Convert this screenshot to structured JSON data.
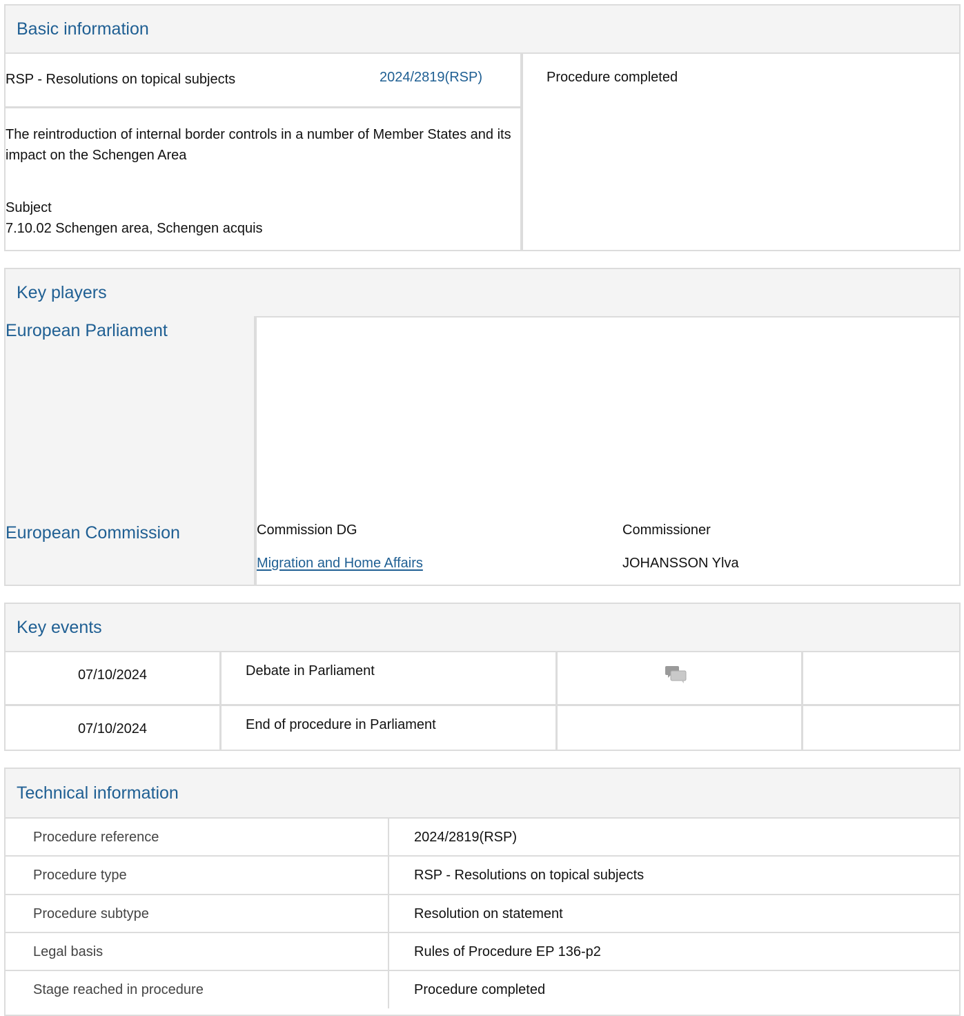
{
  "basic_information": {
    "heading": "Basic information",
    "procedure_type": "RSP - Resolutions on topical subjects",
    "procedure_reference_link": "2024/2819(RSP)",
    "status": "Procedure completed",
    "title": "The reintroduction of internal border controls in a number of Member States and its impact on the Schengen Area",
    "subject_label": "Subject",
    "subject_value": "7.10.02 Schengen area, Schengen acquis"
  },
  "key_players": {
    "heading": "Key players",
    "parliament_label": "European Parliament",
    "commission_label": "European Commission",
    "commission_dg_header": "Commission DG",
    "commissioner_header": "Commissioner",
    "commission_dg_value": "Migration and Home Affairs",
    "commissioner_value": "JOHANSSON Ylva"
  },
  "key_events": {
    "heading": "Key events",
    "rows": [
      {
        "date": "07/10/2024",
        "event": "Debate in Parliament",
        "icon": "debate-icon"
      },
      {
        "date": "07/10/2024",
        "event": "End of procedure in Parliament",
        "icon": ""
      }
    ]
  },
  "technical_information": {
    "heading": "Technical information",
    "rows": [
      {
        "label": "Procedure reference",
        "value": "2024/2819(RSP)"
      },
      {
        "label": "Procedure type",
        "value": "RSP - Resolutions on topical subjects"
      },
      {
        "label": "Procedure subtype",
        "value": "Resolution on statement"
      },
      {
        "label": "Legal basis",
        "value": "Rules of Procedure EP 136-p2"
      },
      {
        "label": "Stage reached in procedure",
        "value": "Procedure completed"
      }
    ]
  },
  "colors": {
    "accent_blue": "#1f5f93",
    "border_gray": "#dcdcdc",
    "header_bg": "#f4f4f4",
    "label_bg": "#f4f4f4"
  }
}
